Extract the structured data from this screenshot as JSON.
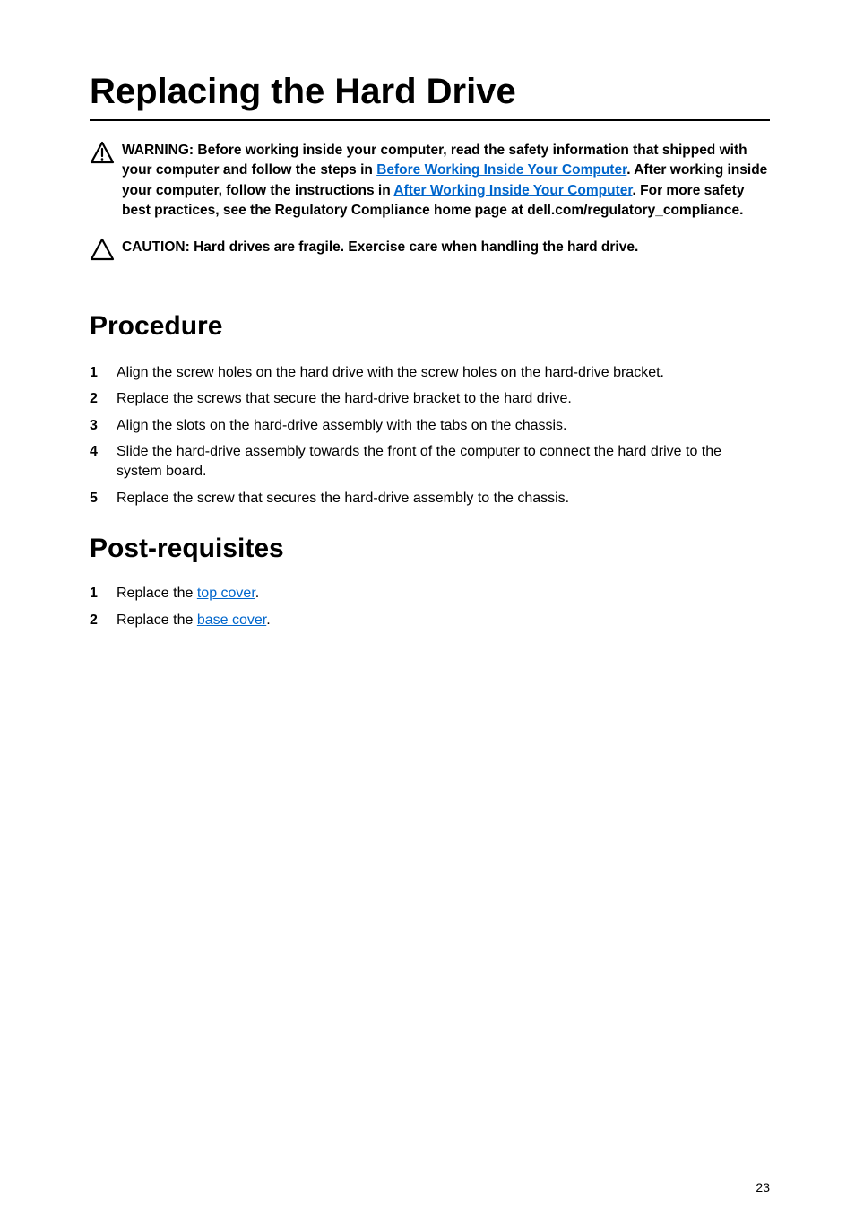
{
  "title": "Replacing the Hard Drive",
  "warning": {
    "pre": "WARNING: Before working inside your computer, read the safety information that shipped with your computer and follow the steps in ",
    "link1": "Before Working Inside Your Computer",
    "mid": ". After working inside your computer, follow the instructions in ",
    "link2": "After Working Inside Your Computer",
    "post": ". For more safety best practices, see the Regulatory Compliance home page at dell.com/regulatory_compliance."
  },
  "caution": "CAUTION: Hard drives are fragile. Exercise care when handling the hard drive.",
  "procedure_heading": "Procedure",
  "procedure_steps": [
    "Align the screw holes on the hard drive with the screw holes on the hard-drive bracket.",
    "Replace the screws that secure the hard-drive bracket to the hard drive.",
    "Align the slots on the hard-drive assembly with the tabs on the chassis.",
    "Slide the hard-drive assembly towards the front of the computer to connect the hard drive to the system board.",
    "Replace the screw that secures the hard-drive assembly to the chassis."
  ],
  "post_heading": "Post-requisites",
  "post_steps": [
    {
      "pre": "Replace the ",
      "link": "top cover",
      "post": "."
    },
    {
      "pre": "Replace the ",
      "link": "base cover",
      "post": "."
    }
  ],
  "page_number": "23"
}
